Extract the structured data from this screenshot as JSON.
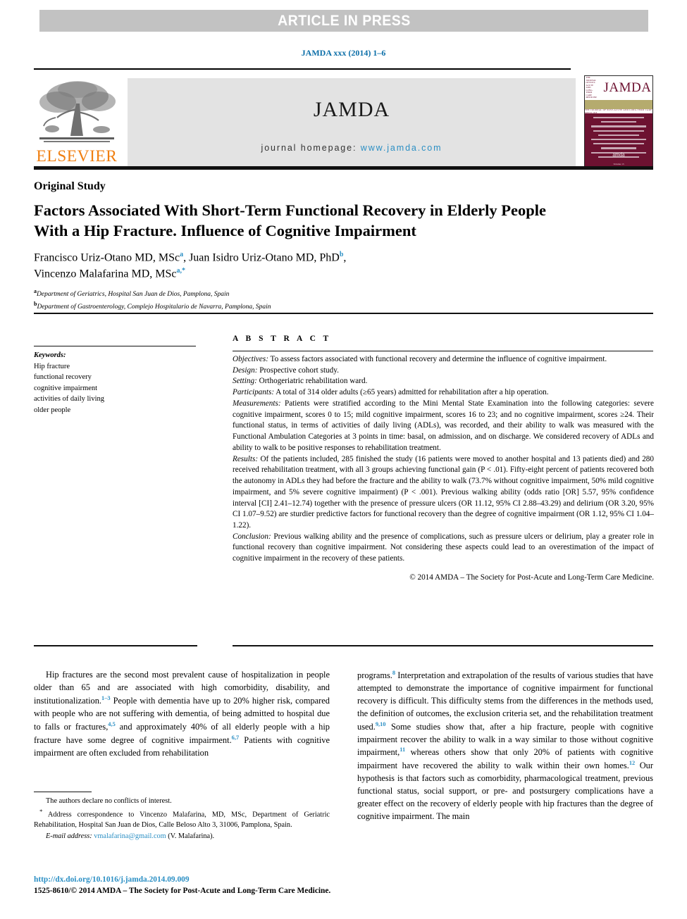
{
  "banner": {
    "text": "ARTICLE IN PRESS"
  },
  "citation": {
    "text": "JAMDA xxx (2014) 1–6",
    "color": "#0b6ea8"
  },
  "masthead": {
    "publisher_logo_text": "ELSEVIER",
    "publisher_logo_color": "#f07f11",
    "journal_title": "JAMDA",
    "homepage_label": "journal homepage:",
    "homepage_url": "www.jamda.com",
    "homepage_url_color": "#2b8fc4",
    "cover": {
      "title": "JAMDA",
      "subtitle": "THE JOURNAL OF POST-ACUTE AND LONG-TERM CARE MEDICINE",
      "logo": "amda",
      "footer": "Volume 15",
      "brand_color": "#6d1231",
      "band_color": "#b5ab6e"
    }
  },
  "article": {
    "type": "Original Study",
    "title": "Factors Associated With Short-Term Functional Recovery in Elderly People With a Hip Fracture. Influence of Cognitive Impairment",
    "authors_line1_a": "Francisco Uriz-Otano MD, MSc",
    "authors_line1_sup_a": "a",
    "authors_line1_b": ", Juan Isidro Uriz-Otano MD, PhD",
    "authors_line1_sup_b": "b",
    "authors_line1_c": ",",
    "authors_line2_a": "Vincenzo Malafarina MD, MSc",
    "authors_line2_sup": "a,*",
    "affiliation_a_marker": "a",
    "affiliation_a": "Department of Geriatrics, Hospital San Juan de Dios, Pamplona, Spain",
    "affiliation_b_marker": "b",
    "affiliation_b": "Department of Gastroenterology, Complejo Hospitalario de Navarra, Pamplona, Spain"
  },
  "keywords": {
    "label": "Keywords:",
    "items": [
      "Hip fracture",
      "functional recovery",
      "cognitive impairment",
      "activities of daily living",
      "older people"
    ]
  },
  "abstract": {
    "heading": "A B S T R A C T",
    "objectives_label": "Objectives:",
    "objectives": " To assess factors associated with functional recovery and determine the influence of cognitive impairment.",
    "design_label": "Design:",
    "design": " Prospective cohort study.",
    "setting_label": "Setting:",
    "setting": " Orthogeriatric rehabilitation ward.",
    "participants_label": "Participants:",
    "participants": " A total of 314 older adults (≥65 years) admitted for rehabilitation after a hip operation.",
    "measurements_label": "Measurements:",
    "measurements": " Patients were stratified according to the Mini Mental State Examination into the following categories: severe cognitive impairment, scores 0 to 15; mild cognitive impairment, scores 16 to 23; and no cognitive impairment, scores ≥24. Their functional status, in terms of activities of daily living (ADLs), was recorded, and their ability to walk was measured with the Functional Ambulation Categories at 3 points in time: basal, on admission, and on discharge. We considered recovery of ADLs and ability to walk to be positive responses to rehabilitation treatment.",
    "results_label": "Results:",
    "results": " Of the patients included, 285 finished the study (16 patients were moved to another hospital and 13 patients died) and 280 received rehabilitation treatment, with all 3 groups achieving functional gain (P < .01). Fifty-eight percent of patients recovered both the autonomy in ADLs they had before the fracture and the ability to walk (73.7% without cognitive impairment, 50% mild cognitive impairment, and 5% severe cognitive impairment) (P < .001). Previous walking ability (odds ratio [OR] 5.57, 95% confidence interval [CI] 2.41–12.74) together with the presence of pressure ulcers (OR 11.12, 95% CI 2.88–43.29) and delirium (OR 3.20, 95% CI 1.07–9.52) are sturdier predictive factors for functional recovery than the degree of cognitive impairment (OR 1.12, 95% CI 1.04–1.22).",
    "conclusion_label": "Conclusion:",
    "conclusion": " Previous walking ability and the presence of complications, such as pressure ulcers or delirium, play a greater role in functional recovery than cognitive impairment. Not considering these aspects could lead to an overestimation of the impact of cognitive impairment in the recovery of these patients.",
    "copyright": "© 2014 AMDA – The Society for Post-Acute and Long-Term Care Medicine."
  },
  "body": {
    "left_col": {
      "seg1": "Hip fractures are the second most prevalent cause of hospitalization in people older than 65 and are associated with high comorbidity, disability, and institutionalization.",
      "ref1": "1–3",
      "seg2": " People with dementia have up to 20% higher risk, compared with people who are not suffering with dementia, of being admitted to hospital due to falls or fractures,",
      "ref2": "4,5",
      "seg3": " and approximately 40% of all elderly people with a hip fracture have some degree of cognitive impairment.",
      "ref3": "6,7",
      "seg4": " Patients with cognitive impairment are often excluded from rehabilitation"
    },
    "right_col": {
      "seg1": "programs.",
      "ref1": "8",
      "seg2": " Interpretation and extrapolation of the results of various studies that have attempted to demonstrate the importance of cognitive impairment for functional recovery is difficult. This difficulty stems from the differences in the methods used, the definition of outcomes, the exclusion criteria set, and the rehabilitation treatment used.",
      "ref2": "9,10",
      "seg3": " Some studies show that, after a hip fracture, people with cognitive impairment recover the ability to walk in a way similar to those without cognitive impairment,",
      "ref3": "11",
      "seg4": " whereas others show that only 20% of patients with cognitive impairment have recovered the ability to walk within their own homes.",
      "ref4": "12",
      "seg5": " Our hypothesis is that factors such as comorbidity, pharmacological treatment, previous functional status, social support, or pre- and postsurgery complications have a greater effect on the recovery of elderly people with hip fractures than the degree of cognitive impairment. The main"
    }
  },
  "footnote": {
    "conflicts": "The authors declare no conflicts of interest.",
    "correspondence_marker": "*",
    "correspondence": " Address correspondence to Vincenzo Malafarina, MD, MSc, Department of Geriatric Rehabilitation, Hospital San Juan de Dios, Calle Beloso Alto 3, 31006, Pamplona, Spain.",
    "email_label": "E-mail address:",
    "email": "vmalafarina@gmail.com",
    "email_suffix": " (V. Malafarina).",
    "doi": "http://dx.doi.org/10.1016/j.jamda.2014.09.009",
    "issn_line": "1525-8610/© 2014 AMDA – The Society for Post-Acute and Long-Term Care Medicine."
  }
}
